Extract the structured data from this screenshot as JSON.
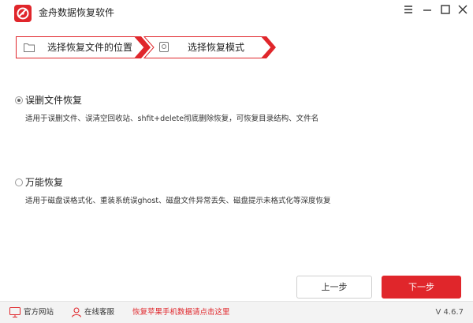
{
  "app": {
    "title": "金舟数据恢复软件"
  },
  "window_controls": [
    "menu",
    "minimize",
    "maximize",
    "close"
  ],
  "steps": [
    {
      "label": "选择恢复文件的位置",
      "icon": "folder-icon"
    },
    {
      "label": "选择恢复模式",
      "icon": "disk-icon"
    }
  ],
  "options": [
    {
      "title": "误删文件恢复",
      "description": "适用于误删文件、误清空回收站、shfit+delete彻底删除恢复，可恢复目录结构、文件名",
      "selected": true
    },
    {
      "title": "万能恢复",
      "description": "适用于磁盘误格式化、重装系统误ghost、磁盘文件异常丢失、磁盘提示未格式化等深度恢复",
      "selected": false
    }
  ],
  "buttons": {
    "prev": "上一步",
    "next": "下一步"
  },
  "footer": {
    "website": "官方网站",
    "support": "在线客服",
    "promo": "恢复苹果手机数据请点击这里",
    "version": "V 4.6.7"
  },
  "colors": {
    "accent": "#e0262b",
    "promo_text": "#e0262b"
  }
}
